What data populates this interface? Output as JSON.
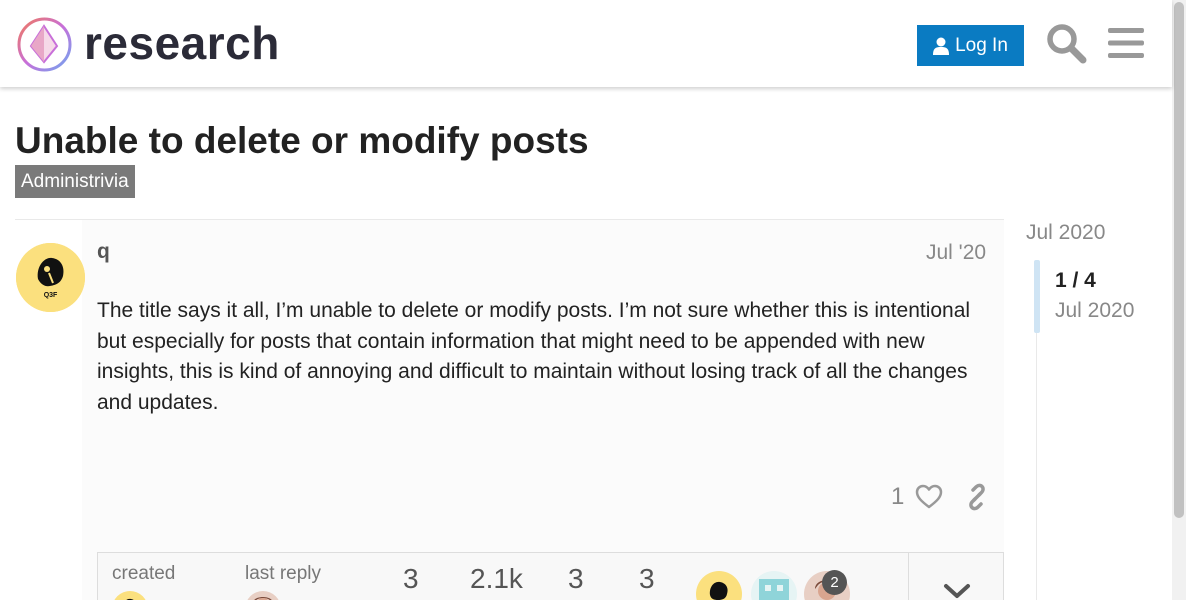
{
  "header": {
    "brand": "research",
    "login_label": "Log In"
  },
  "topic": {
    "title": "Unable to delete or modify posts",
    "category": "Administrivia"
  },
  "post": {
    "username": "q",
    "date": "Jul '20",
    "body": "The title says it all, I’m unable to delete or modify posts. I’m not sure whether this is intentional but especially for posts that contain information that might need to be appended with new insights, this is kind of annoying and difficult to maintain without losing track of all the changes and updates.",
    "like_count": "1"
  },
  "topic_map": {
    "created_label": "created",
    "last_reply_label": "last reply",
    "replies": "3",
    "views": "2.1k",
    "users": "3",
    "links": "3",
    "top_poster_count": "2"
  },
  "timeline": {
    "top_date": "Jul 2020",
    "progress": "1 / 4",
    "current_date": "Jul 2020"
  },
  "colors": {
    "primary_button": "#0a7bc2",
    "category_badge": "#7a7a7a",
    "avatar_yellow": "#fbe07e",
    "timeline_handle": "#cfe4f4"
  },
  "icons": [
    "logo-icon",
    "user-icon",
    "search-icon",
    "menu-icon",
    "heart-icon",
    "link-icon",
    "chevron-down-icon"
  ]
}
